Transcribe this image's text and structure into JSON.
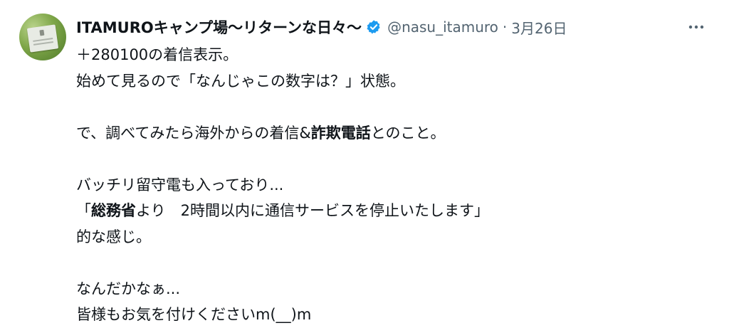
{
  "tweet": {
    "display_name": "ITAMUROキャンプ場〜リターンな日々〜",
    "handle": "@nasu_itamuro",
    "separator": "·",
    "date": "3月26日",
    "verified_color": "#1d9bf0",
    "avatar_icon": "avatar-photo",
    "more_icon": "more-horizontal-icon",
    "lines": {
      "l1": "＋280100の着信表示。",
      "l2": "始めて見るので「なんじゃこの数字は？」状態。",
      "l4a": "で、調べてみたら海外からの着信&",
      "l4b": "詐欺電話",
      "l4c": "とのこと。",
      "l6": "バッチリ留守電も入っており...",
      "l7a": "「",
      "l7b": "総務省",
      "l7c": "より　2時間以内に通信サービスを停止いたします」",
      "l8": "的な感じ。",
      "l10": "なんだかなぁ...",
      "l11": "皆様もお気を付けくださいm(__)m"
    }
  }
}
